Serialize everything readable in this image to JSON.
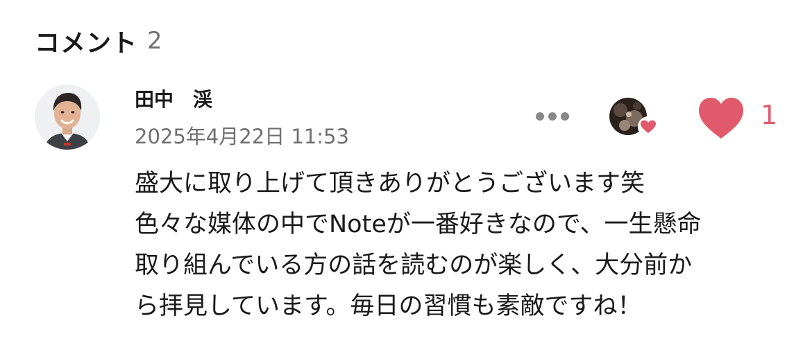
{
  "comments": {
    "title": "コメント",
    "count": "2"
  },
  "comment": {
    "author": {
      "name": "田中　渓",
      "avatar_icon": "user-avatar-photo"
    },
    "timestamp": "2025年4月22日 11:53",
    "body_lines": [
      "盛大に取り上げて頂きありがとうございます笑",
      "色々な媒体の中でNoteが一番好きなので、一生懸命",
      "取り組んでいる方の話を読むのが楽しく、大分前か",
      "ら拝見しています。毎日の習慣も素敵ですね！"
    ],
    "more_icon": "more-dots-icon",
    "liker_icon": "liked-by-avatar",
    "like": {
      "icon": "heart-icon",
      "count": "1"
    }
  },
  "colors": {
    "like_accent": "#e05a6b",
    "muted_text": "#6f6f6f",
    "main_text": "#1a1a1a",
    "dots": "#888888"
  }
}
